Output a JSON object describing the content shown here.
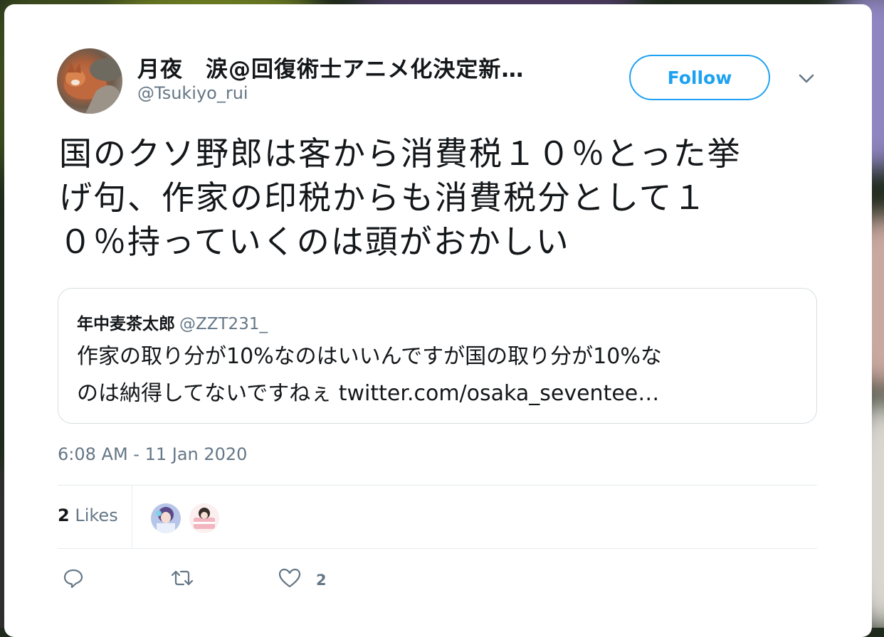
{
  "tweet": {
    "display_name": "月夜　涙@回復術士アニメ化決定新…",
    "handle": "@Tsukiyo_rui",
    "follow_label": "Follow",
    "text_lines": [
      "国のクソ野郎は客から消費税１０％とった挙",
      "げ句、作家の印税からも消費税分として１",
      "０％持っていくのは頭がおかしい"
    ],
    "timestamp": "6:08 AM - 11 Jan 2020",
    "likes_number": "2",
    "likes_word": "Likes",
    "like_action_count": "2"
  },
  "quoted": {
    "name": "年中麦茶太郎",
    "handle": "@ZZT231_",
    "text_line1": "作家の取り分が10%なのはいいんですが国の取り分が10%な",
    "text_line2": "のは納得してないですねぇ ",
    "link": "twitter.com/osaka_sevente​e…"
  },
  "icons": {
    "reply": "reply-icon",
    "retweet": "retweet-icon",
    "like": "heart-icon",
    "menu": "chevron-down-icon"
  },
  "colors": {
    "accent": "#1da1f2",
    "secondary_text": "#657786",
    "primary_text": "#14171a"
  }
}
